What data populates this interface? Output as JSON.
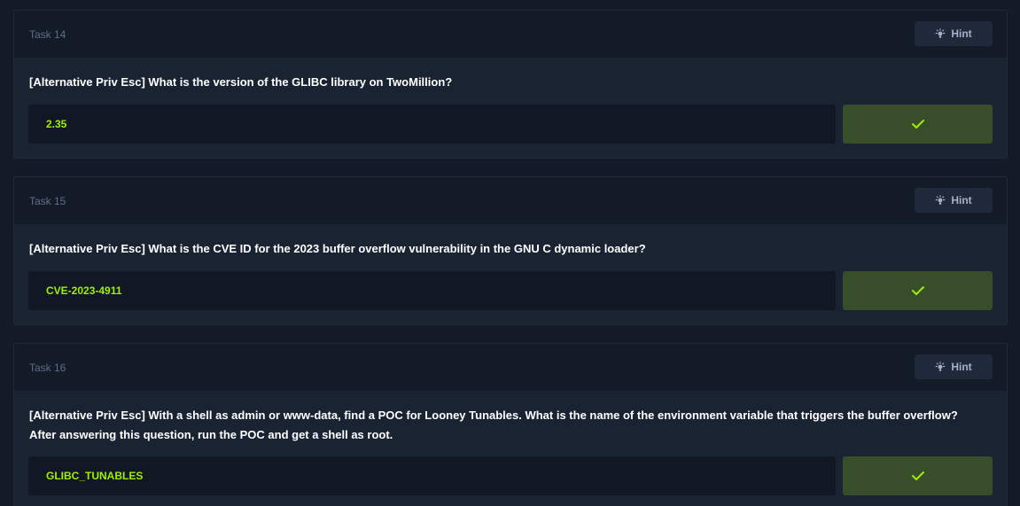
{
  "tasks": [
    {
      "label": "Task 14",
      "hint_label": "Hint",
      "question": "[Alternative Priv Esc] What is the version of the GLIBC library on TwoMillion?",
      "answer": "2.35"
    },
    {
      "label": "Task 15",
      "hint_label": "Hint",
      "question": "[Alternative Priv Esc] What is the CVE ID for the 2023 buffer overflow vulnerability in the GNU C dynamic loader?",
      "answer": "CVE-2023-4911"
    },
    {
      "label": "Task 16",
      "hint_label": "Hint",
      "question": "[Alternative Priv Esc] With a shell as admin or www-data, find a POC for Looney Tunables. What is the name of the environment variable that triggers the buffer overflow? After answering this question, run the POC and get a shell as root.",
      "answer": "GLIBC_TUNABLES"
    }
  ],
  "colors": {
    "accent_green": "#9fef00",
    "submit_bg": "#384d2a",
    "label_muted": "#5d6e89"
  },
  "icons": {
    "hint": "lightbulb-icon",
    "submit": "checkmark-icon"
  }
}
